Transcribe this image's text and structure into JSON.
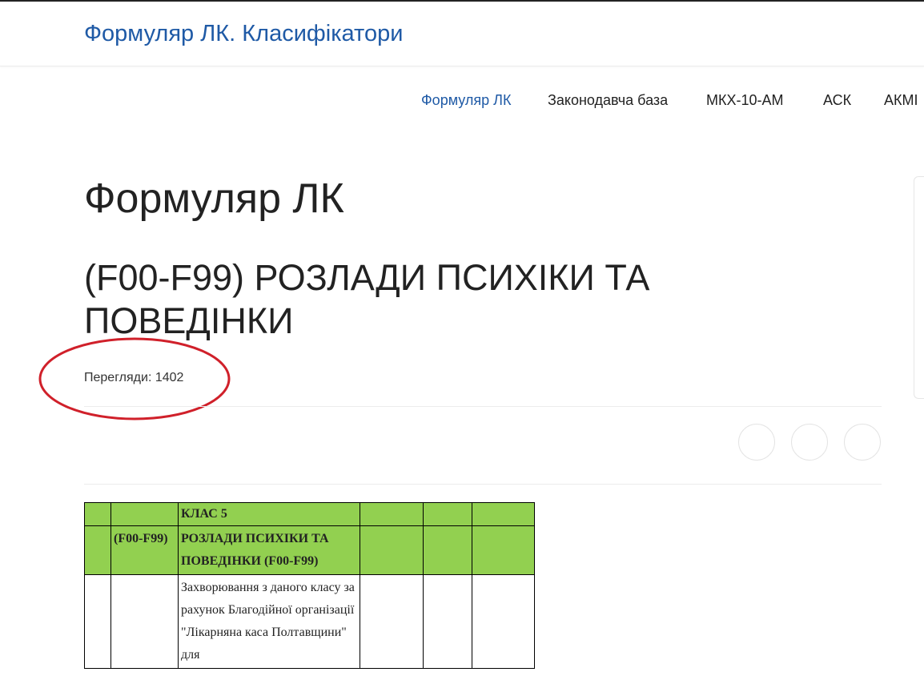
{
  "header": {
    "site_title": "Формуляр ЛК. Класифікатори"
  },
  "nav": {
    "items": [
      {
        "label": "Формуляр ЛК",
        "active": true
      },
      {
        "label": "Законодавча база"
      },
      {
        "label": "МКХ-10-АМ"
      },
      {
        "label": "АСК"
      },
      {
        "label": "АКМІ"
      }
    ]
  },
  "main": {
    "page_title": "Формуляр ЛК",
    "post_title": "(F00-F99) РОЗЛАДИ ПСИХІКИ ТА ПОВЕДІНКИ",
    "views": "Перегляди: 1402"
  },
  "table": {
    "row1": {
      "class_label": "КЛАС 5"
    },
    "row2": {
      "code": "(F00-F99)",
      "title": "РОЗЛАДИ ПСИХІКИ ТА ПОВЕДІНКИ (F00-F99)"
    },
    "row3": {
      "text": "Захворювання з даного класу за рахунок Благодійної організації \"Лікарняна каса Полтавщини\" для"
    }
  },
  "colors": {
    "accent": "#1f5aa6",
    "table_header": "#92d050",
    "annotation": "#d0202a"
  }
}
